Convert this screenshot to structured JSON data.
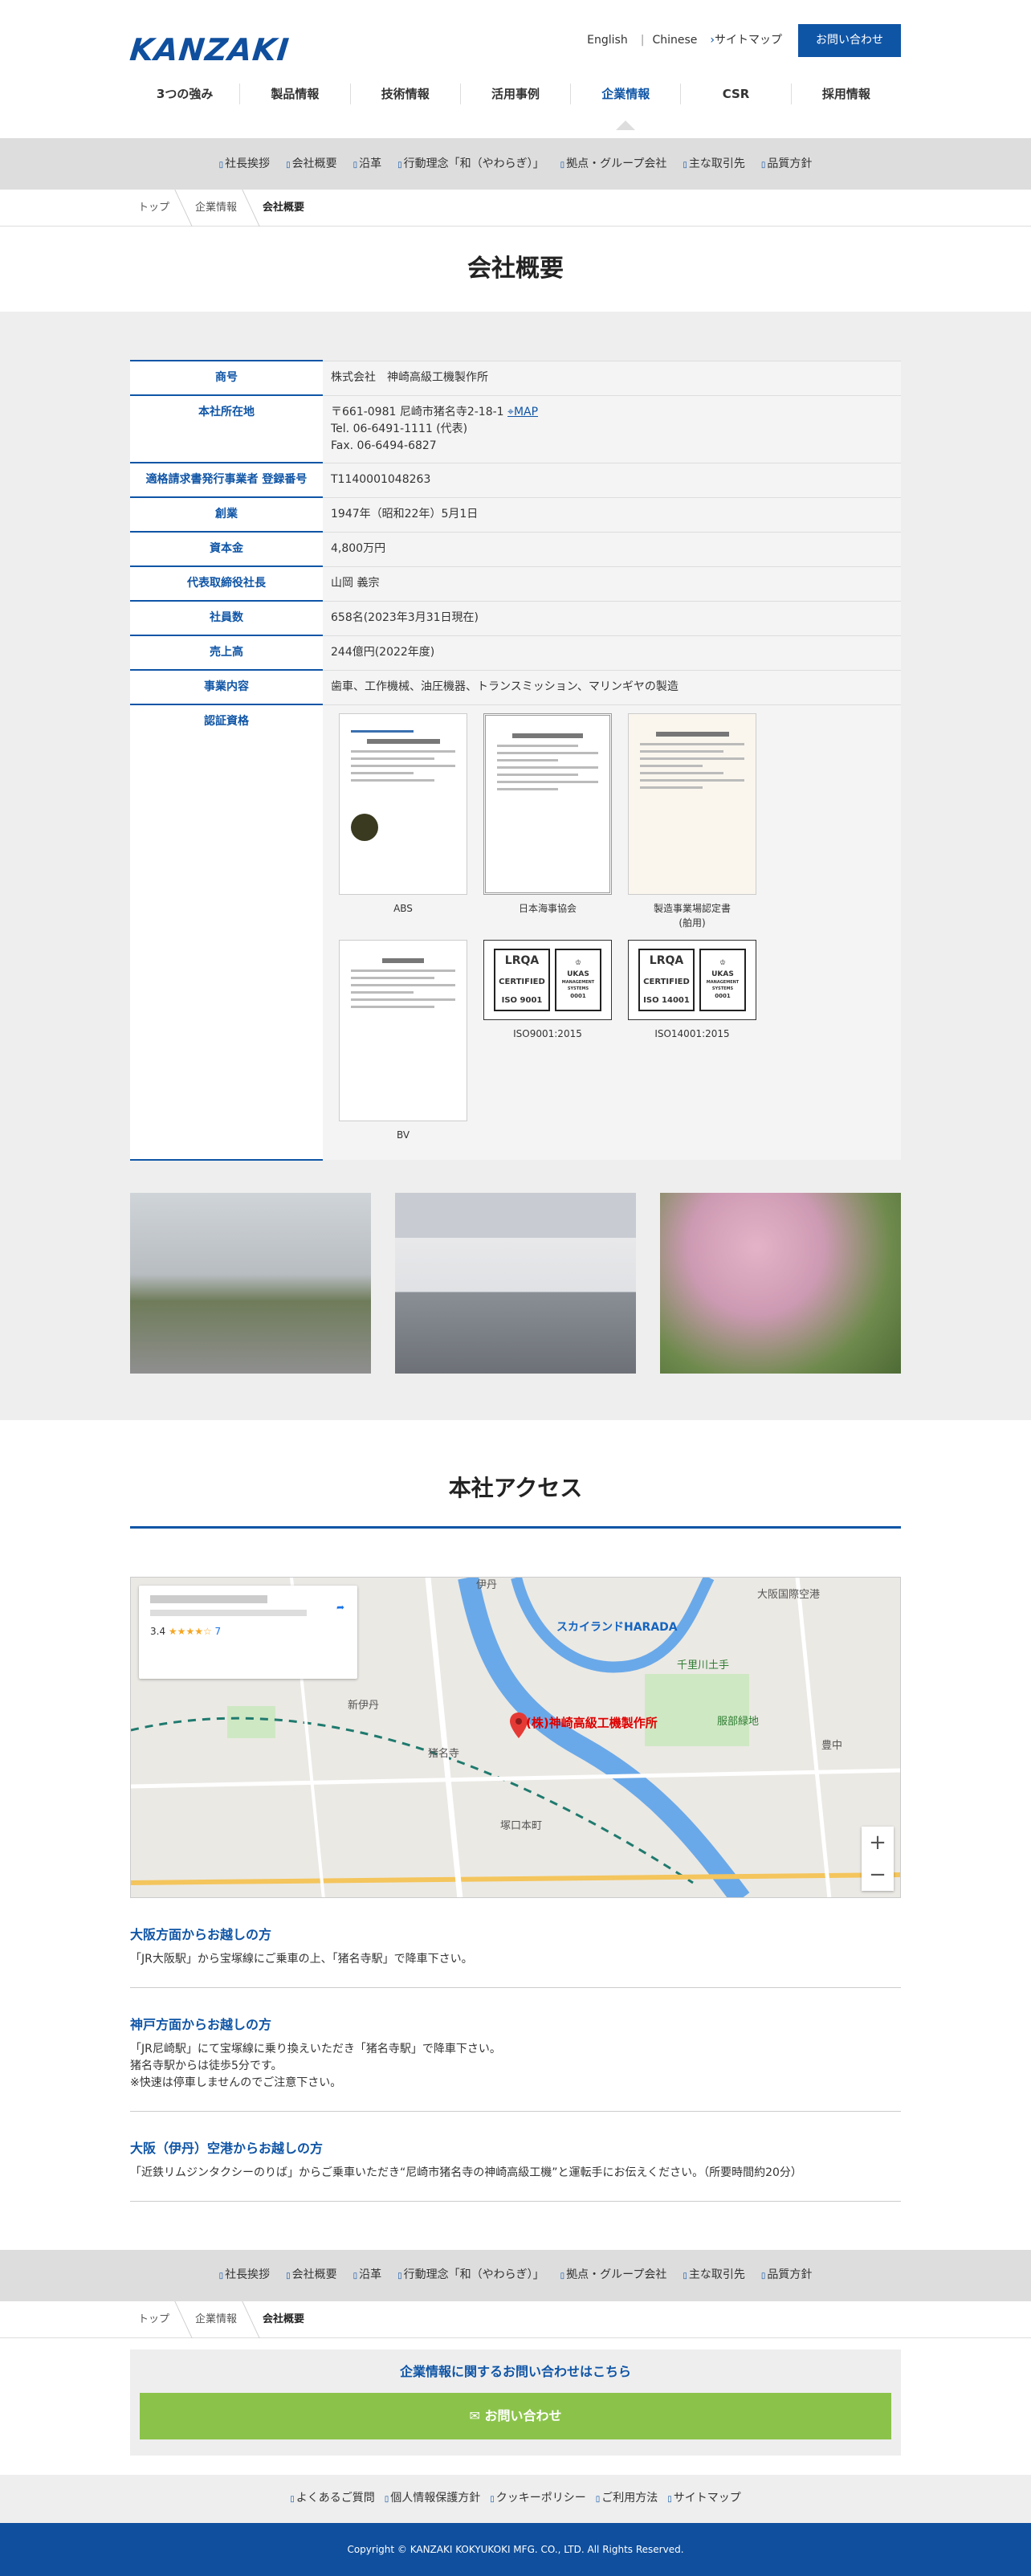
{
  "header": {
    "logo": "KANZAKI",
    "links": [
      "English",
      "Chinese",
      "サイトマップ"
    ],
    "contact_label": "お問い合わせ",
    "gnav": [
      "3つの強み",
      "製品情報",
      "技術情報",
      "活用事例",
      "企業情報",
      "CSR",
      "採用情報"
    ]
  },
  "subnav": [
    "社長挨拶",
    "会社概要",
    "沿革",
    "行動理念「和（やわらぎ）」",
    "拠点・グループ会社",
    "主な取引先",
    "品質方針"
  ],
  "breadcrumb": [
    "トップ",
    "企業情報",
    "会社概要"
  ],
  "page_title": "会社概要",
  "company": {
    "rows": [
      {
        "label": "商号",
        "value": "株式会社　神崎高級工機製作所"
      },
      {
        "label": "本社所在地",
        "value": "〒661-0981 尼崎市猪名寺2-18-1",
        "link": "MAP",
        "tel": "Tel. 06-6491-1111 (代表)",
        "fax": "Fax. 06-6494-6827"
      },
      {
        "label": "適格請求書発行事業者 登録番号",
        "value": "T1140001048263"
      },
      {
        "label": "創業",
        "value": "1947年（昭和22年）5月1日"
      },
      {
        "label": "資本金",
        "value": "4,800万円"
      },
      {
        "label": "代表取締役社長",
        "value": "山岡 義宗"
      },
      {
        "label": "社員数",
        "value": "658名(2023年3月31日現在)"
      },
      {
        "label": "売上高",
        "value": "244億円(2022年度)"
      },
      {
        "label": "事業内容",
        "value": "歯車、工作機械、油圧機器、トランスミッション、マリンギヤの製造"
      },
      {
        "label": "認証資格",
        "value": ""
      }
    ],
    "certs": [
      "ABS",
      "日本海事協会",
      "製造事業場認定書\n(舶用)",
      "BV"
    ],
    "iso": [
      "ISO9001:2015",
      "ISO14001:2015"
    ],
    "iso_badges": [
      {
        "lrqa": "LRQA",
        "certified": "CERTIFIED",
        "standard": "ISO 9001",
        "ukas": "UKAS",
        "ukas_sub": "MANAGEMENT SYSTEMS",
        "num": "0001"
      },
      {
        "lrqa": "LRQA",
        "certified": "CERTIFIED",
        "standard": "ISO 14001",
        "ukas": "UKAS",
        "ukas_sub": "MANAGEMENT SYSTEMS",
        "num": "0001"
      }
    ]
  },
  "access": {
    "title": "本社アクセス",
    "map": {
      "rating": "3.4",
      "reviews": "7",
      "marker_label": "(株)神崎高級工機製作所",
      "labels": [
        "伊丹",
        "新伊丹",
        "猪名寺",
        "塚口本町",
        "スカイランドHARADA",
        "千里川土手",
        "服部緑地",
        "大阪国際空港",
        "豊中"
      ]
    },
    "routes": [
      {
        "title": "大阪方面からお越しの方",
        "text": "「JR大阪駅」から宝塚線にご乗車の上、「猪名寺駅」で降車下さい。"
      },
      {
        "title": "神戸方面からお越しの方",
        "text": "「JR尼崎駅」にて宝塚線に乗り換えいただき「猪名寺駅」で降車下さい。\n猪名寺駅からは徒歩5分です。\n※快速は停車しませんのでご注意下さい。"
      },
      {
        "title": "大阪（伊丹）空港からお越しの方",
        "text": "「近鉄リムジンタクシーのりば」からご乗車いただき“尼崎市猪名寺の神崎高級工機”と運転手にお伝えください。（所要時間約20分）"
      }
    ]
  },
  "inquiry": {
    "title": "企業情報に関するお問い合わせはこちら",
    "button": "お問い合わせ"
  },
  "footer_links": [
    "よくあるご質問",
    "個人情報保護方針",
    "クッキーポリシー",
    "ご利用方法",
    "サイトマップ"
  ],
  "copyright": "Copyright © KANZAKI KOKYUKOKI MFG. CO., LTD. All Rights Reserved.",
  "colors": {
    "brand": "#0f55a6",
    "button_green": "#8bc34a",
    "gray_bg": "#eeeeee"
  }
}
